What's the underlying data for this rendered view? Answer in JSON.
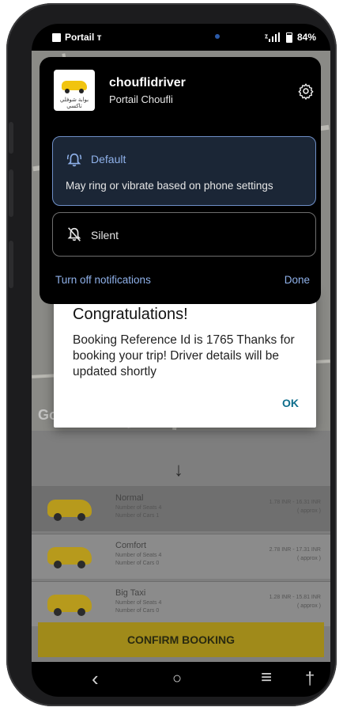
{
  "status_bar": {
    "app_label": "Portail т",
    "battery": "84%"
  },
  "notification": {
    "app_name": "chouflidriver",
    "app_subtitle": "Portail Choufli",
    "app_icon_text": "بوابة شوفلي تاكسي",
    "options": [
      {
        "label": "Default",
        "description": "May ring or vibrate based on phone settings",
        "selected": true
      },
      {
        "label": "Silent",
        "selected": false
      }
    ],
    "turn_off_label": "Turn off notifications",
    "done_label": "Done"
  },
  "dialog": {
    "title": "Congratulations!",
    "message": "Booking Reference Id is 1765 Thanks for booking your trip! Driver details will be updated shortly",
    "ok_label": "OK"
  },
  "map": {
    "watermark": "Go"
  },
  "booking": {
    "arrow": "↓",
    "cars": [
      {
        "name": "Normal",
        "seats": "Number of Seats 4",
        "cars": "Number of Cars 1",
        "price": "1.78 INR - 16.31 INR",
        "approx": "( approx )"
      },
      {
        "name": "Comfort",
        "seats": "Number of Seats 4",
        "cars": "Number of Cars 0",
        "price": "2.78 INR - 17.31 INR",
        "approx": "( approx )"
      },
      {
        "name": "Big Taxi",
        "seats": "Number of Seats 4",
        "cars": "Number of Cars 0",
        "price": "1.28 INR - 15.81 INR",
        "approx": "( approx )"
      }
    ],
    "confirm_label": "CONFIRM BOOKING"
  },
  "nav": {
    "back": "‹",
    "home": "○",
    "recents": "≡",
    "accessibility": "†"
  },
  "colors": {
    "accent_blue": "#8fb1ea",
    "dialog_ok": "#0f6e8c",
    "confirm_bg": "#a08a1a"
  }
}
